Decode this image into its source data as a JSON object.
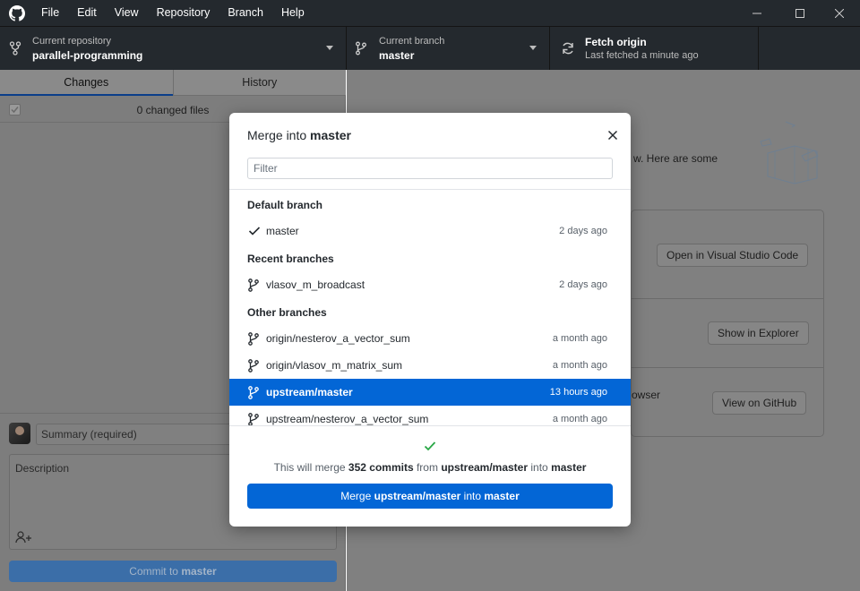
{
  "menu": [
    "File",
    "Edit",
    "View",
    "Repository",
    "Branch",
    "Help"
  ],
  "toolbar": {
    "repo_label": "Current repository",
    "repo_value": "parallel-programming",
    "branch_label": "Current branch",
    "branch_value": "master",
    "fetch_label": "Fetch origin",
    "fetch_sub": "Last fetched a minute ago"
  },
  "sidebar": {
    "tabs": [
      "Changes",
      "History"
    ],
    "changed_files": "0 changed files",
    "summary_placeholder": "Summary (required)",
    "description_placeholder": "Description",
    "commit_prefix": "Commit to",
    "commit_branch": "master"
  },
  "main": {
    "intro_text": "w. Here are some",
    "open_editor": "Open in Visual Studio Code",
    "show_explorer": "Show in Explorer",
    "browser_text": "owser",
    "view_github": "View on GitHub"
  },
  "dialog": {
    "title_prefix": "Merge into",
    "title_branch": "master",
    "filter_placeholder": "Filter",
    "groups": {
      "default": "Default branch",
      "recent": "Recent branches",
      "other": "Other branches"
    },
    "branches": {
      "default": [
        {
          "name": "master",
          "time": "2 days ago"
        }
      ],
      "recent": [
        {
          "name": "vlasov_m_broadcast",
          "time": "2 days ago"
        }
      ],
      "other": [
        {
          "name": "origin/nesterov_a_vector_sum",
          "time": "a month ago"
        },
        {
          "name": "origin/vlasov_m_matrix_sum",
          "time": "a month ago"
        },
        {
          "name": "upstream/master",
          "time": "13 hours ago"
        },
        {
          "name": "upstream/nesterov_a_vector_sum",
          "time": "a month ago"
        }
      ]
    },
    "merge_info": {
      "prefix": "This will merge",
      "count": "352 commits",
      "mid": "from",
      "source": "upstream/master",
      "into": "into",
      "target": "master"
    },
    "merge_button": {
      "prefix": "Merge",
      "source": "upstream/master",
      "mid": "into",
      "target": "master"
    }
  },
  "colors": {
    "accent": "#0366d6",
    "titlebar": "#24292e",
    "success": "#28a745"
  }
}
